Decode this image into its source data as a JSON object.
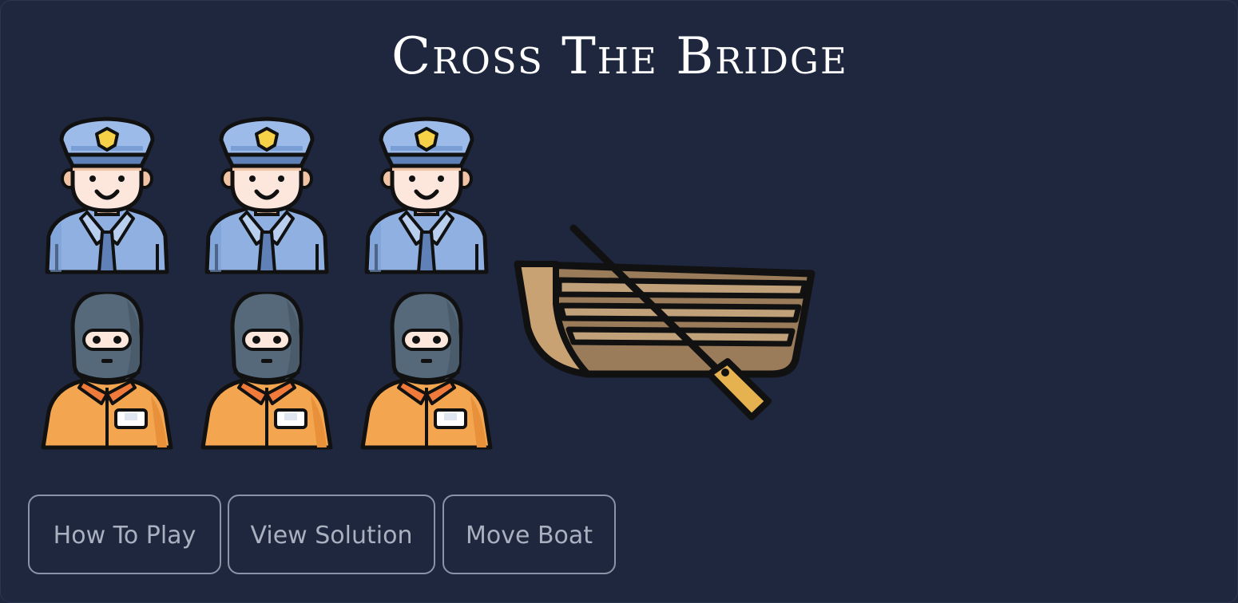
{
  "game": {
    "title": "Cross The Bridge"
  },
  "characters": {
    "police": [
      "police-officer",
      "police-officer",
      "police-officer"
    ],
    "thieves": [
      "masked-thief",
      "masked-thief",
      "masked-thief"
    ]
  },
  "colors": {
    "background": "#1e273d",
    "title": "#ffffff",
    "button_border": "#8a94a8",
    "button_text": "#a9b0c0"
  },
  "buttons": {
    "how_to_play": "How To Play",
    "view_solution": "View Solution",
    "move_boat": "Move Boat"
  }
}
